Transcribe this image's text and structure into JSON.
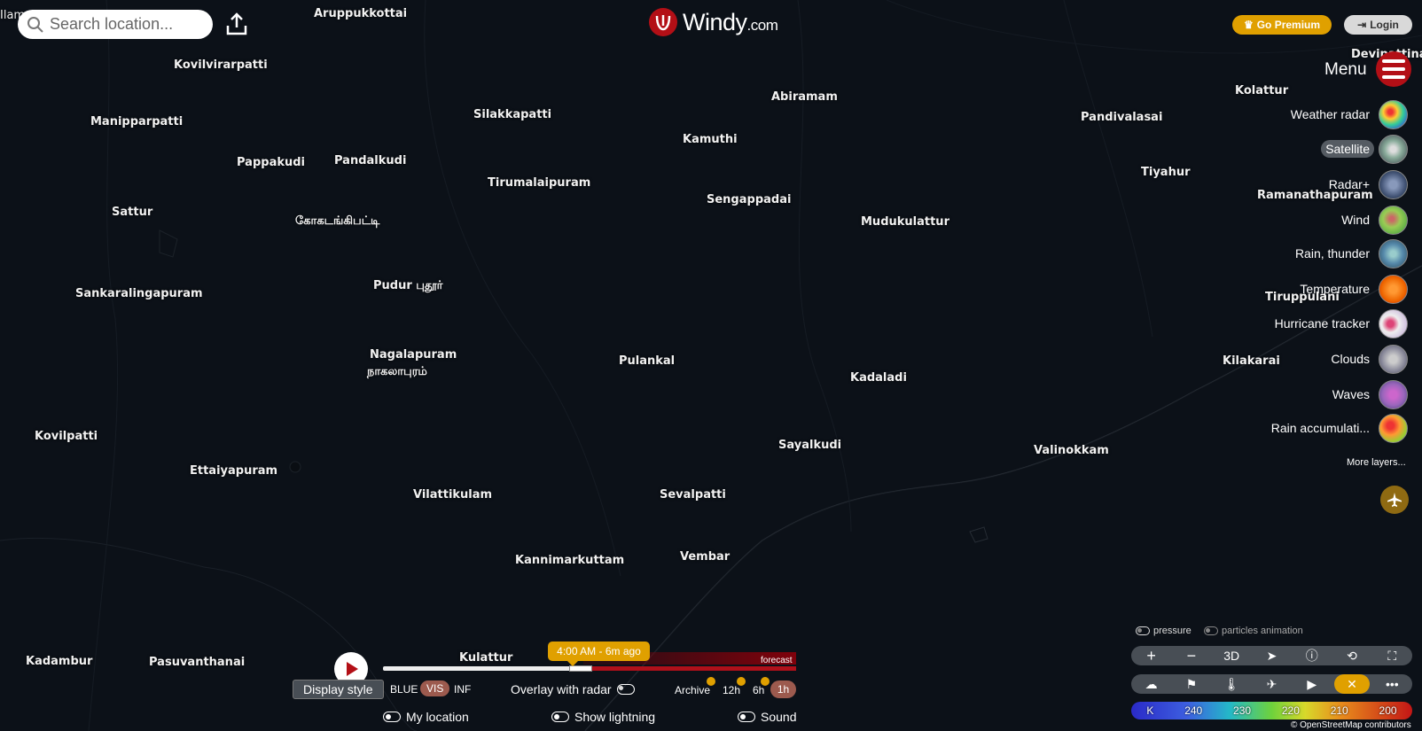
{
  "search": {
    "placeholder": "Search location..."
  },
  "logo": {
    "name": "Windy",
    "suffix": ".com"
  },
  "header": {
    "premium_label": "Go Premium",
    "login_label": "Login"
  },
  "menu": {
    "label": "Menu"
  },
  "layers": [
    {
      "label": "Weather radar",
      "active": false
    },
    {
      "label": "Satellite",
      "active": true
    },
    {
      "label": "Radar+",
      "active": false
    },
    {
      "label": "Wind",
      "active": false
    },
    {
      "label": "Rain, thunder",
      "active": false
    },
    {
      "label": "Temperature",
      "active": false
    },
    {
      "label": "Hurricane tracker",
      "active": false
    },
    {
      "label": "Clouds",
      "active": false
    },
    {
      "label": "Waves",
      "active": false
    },
    {
      "label": "Rain accumulati...",
      "active": false
    }
  ],
  "more_layers": "More layers...",
  "cities": [
    "Aruppukkottai",
    "Kovilvirarpatti",
    "Manipparpatti",
    "Silakkapatti",
    "Abiramam",
    "Kamuthi",
    "Kolattur",
    "Pandivalasai",
    "Pappakudi",
    "Pandalkudi",
    "Tirumalaipuram",
    "Tiyahur",
    "Sattur",
    "கோகடங்கிபட்டி",
    "Sengappadai",
    "Mudukulattur",
    "Ramanathapuram",
    "Sankaralingapuram",
    "Pudur புதூர்",
    "Tiruppulani",
    "Nagalapuram",
    "நாகலாபுரம்",
    "Pulankal",
    "Kadaladi",
    "Kilakarai",
    "Kovilpatti",
    "Sayalkudi",
    "Valinokkam",
    "Ettaiyapuram",
    "Vilattikulam",
    "Sevalpatti",
    "Kannimarkuttam",
    "Vembar",
    "Kadambur",
    "Pasuvanthanai",
    "Kulattur",
    "Devipattinam",
    "Ilam"
  ],
  "map_toggles": {
    "pressure": "pressure",
    "particles": "particles animation"
  },
  "zoom_controls": {
    "plus": "+",
    "minus": "−",
    "three_d": "3D"
  },
  "legend": {
    "unit": "K",
    "values": [
      "240",
      "230",
      "220",
      "210",
      "200"
    ]
  },
  "attribution": "© OpenStreetMap contributors",
  "timeline": {
    "current_time": "4:00 AM - 6m ago",
    "forecast_label": "forecast",
    "display_style": "Display style",
    "modes": [
      "BLUE",
      "VIS",
      "INF"
    ],
    "selected_mode": "VIS",
    "overlay_radar": "Overlay with radar",
    "archive": "Archive",
    "ranges": [
      "12h",
      "6h",
      "1h"
    ],
    "selected_range": "1h"
  },
  "bottom_toggles": {
    "my_location": "My location",
    "lightning": "Show lightning",
    "sound": "Sound"
  },
  "colors": {
    "accent": "#e0a000",
    "brand_red": "#b30f16",
    "map_bg": "#0c1118"
  }
}
